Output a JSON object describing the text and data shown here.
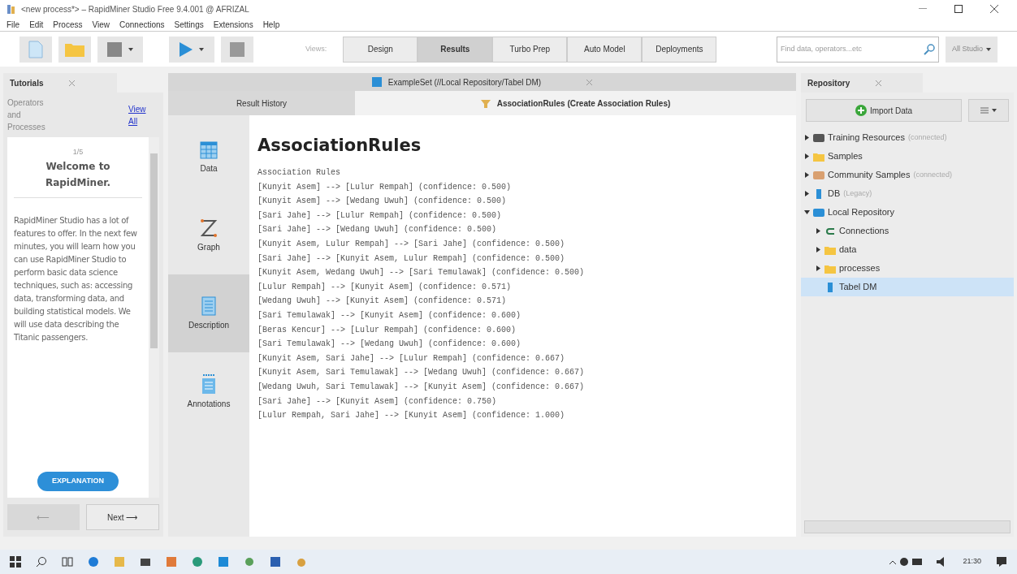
{
  "window": {
    "title": "<new process*> – RapidMiner Studio Free 9.4.001 @ AFRIZAL"
  },
  "menu": [
    "File",
    "Edit",
    "Process",
    "View",
    "Connections",
    "Settings",
    "Extensions",
    "Help"
  ],
  "toolbar": {
    "views_label": "Views:",
    "views": [
      {
        "label": "Design",
        "selected": false
      },
      {
        "label": "Results",
        "selected": true
      },
      {
        "label": "Turbo Prep",
        "selected": false
      },
      {
        "label": "Auto Model",
        "selected": false
      },
      {
        "label": "Deployments",
        "selected": false
      }
    ],
    "search": {
      "placeholder": "Find data, operators...etc"
    },
    "scope": "All Studio"
  },
  "tutorials": {
    "tab": "Tutorials",
    "section": "Operators and Processes",
    "view_all": "View All",
    "page": "1/5",
    "heading": "Welcome to RapidMiner.",
    "body": "RapidMiner Studio has a lot of features to offer. In the next few minutes, you will learn how you can use RapidMiner Studio to perform basic data science techniques, such as: accessing data, transforming data, and building statistical models. We will use data describing the Titanic passengers.",
    "explanation": "EXPLANATION",
    "back": "⟵",
    "next": "Next ⟶"
  },
  "results": {
    "top_tab": "ExampleSet (//Local Repository/Tabel DM)",
    "tabs": [
      {
        "label": "Result History",
        "selected": false
      },
      {
        "label": "AssociationRules (Create Association Rules)",
        "selected": true
      }
    ],
    "views": [
      {
        "label": "Data",
        "selected": false
      },
      {
        "label": "Graph",
        "selected": false
      },
      {
        "label": "Description",
        "selected": true
      },
      {
        "label": "Annotations",
        "selected": false
      }
    ],
    "heading": "AssociationRules",
    "subheading": "Association Rules",
    "rules": [
      "[Kunyit Asem] --> [Lulur Rempah] (confidence: 0.500)",
      "[Kunyit Asem] --> [Wedang Uwuh] (confidence: 0.500)",
      "[Sari Jahe] --> [Lulur Rempah] (confidence: 0.500)",
      "[Sari Jahe] --> [Wedang Uwuh] (confidence: 0.500)",
      "[Kunyit Asem, Lulur Rempah] --> [Sari Jahe] (confidence: 0.500)",
      "[Sari Jahe] --> [Kunyit Asem, Lulur Rempah] (confidence: 0.500)",
      "[Kunyit Asem, Wedang Uwuh] --> [Sari Temulawak] (confidence: 0.500)",
      "[Lulur Rempah] --> [Kunyit Asem] (confidence: 0.571)",
      "[Wedang Uwuh] --> [Kunyit Asem] (confidence: 0.571)",
      "[Sari Temulawak] --> [Kunyit Asem] (confidence: 0.600)",
      "[Beras Kencur] --> [Lulur Rempah] (confidence: 0.600)",
      "[Sari Temulawak] --> [Wedang Uwuh] (confidence: 0.600)",
      "[Kunyit Asem, Sari Jahe] --> [Lulur Rempah] (confidence: 0.667)",
      "[Kunyit Asem, Sari Temulawak] --> [Wedang Uwuh] (confidence: 0.667)",
      "[Wedang Uwuh, Sari Temulawak] --> [Kunyit Asem] (confidence: 0.667)",
      "[Sari Jahe] --> [Kunyit Asem] (confidence: 0.750)",
      "[Lulur Rempah, Sari Jahe] --> [Kunyit Asem] (confidence: 1.000)"
    ]
  },
  "repository": {
    "tab": "Repository",
    "import": "Import Data",
    "tree": [
      {
        "label": "Training Resources",
        "note": "(connected)",
        "kind": "server",
        "expanded": false,
        "selected": false
      },
      {
        "label": "Samples",
        "kind": "folder",
        "expanded": false,
        "selected": false
      },
      {
        "label": "Community Samples",
        "note": "(connected)",
        "kind": "community",
        "expanded": false,
        "selected": false
      },
      {
        "label": "DB",
        "note": "(Legacy)",
        "kind": "db",
        "expanded": false,
        "selected": false
      },
      {
        "label": "Local Repository",
        "kind": "local",
        "expanded": true,
        "selected": false,
        "children": [
          {
            "label": "Connections",
            "kind": "connection",
            "expanded": false,
            "selected": false
          },
          {
            "label": "data",
            "kind": "folder",
            "expanded": false,
            "selected": false
          },
          {
            "label": "processes",
            "kind": "folder",
            "expanded": false,
            "selected": false
          },
          {
            "label": "Tabel DM",
            "kind": "data",
            "selected": true
          }
        ]
      }
    ]
  },
  "taskbar": {
    "clock": "21:30"
  }
}
